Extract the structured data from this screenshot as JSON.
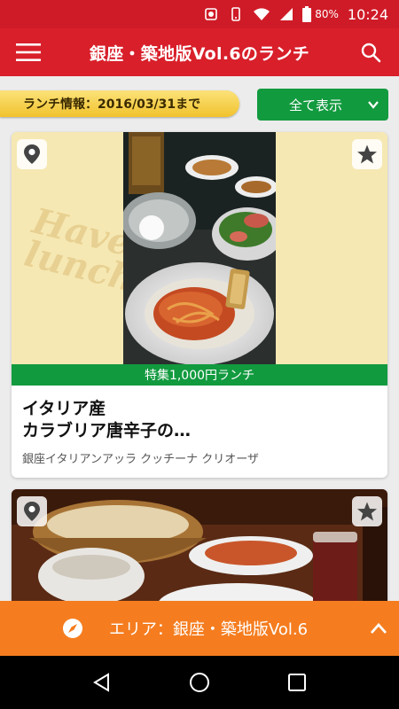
{
  "status": {
    "battery": "80%",
    "time": "10:24"
  },
  "app_bar": {
    "title": "銀座・築地版Vol.6のランチ"
  },
  "info": {
    "banner": "ランチ情報：2016/03/31まで",
    "show_all": "全て表示"
  },
  "cards": [
    {
      "bg_text": "Have a nice lunch!",
      "tag": "特集1,000円ランチ",
      "title_line1": "イタリア産",
      "title_line2": "カラブリア唐辛子の…",
      "shop": "銀座イタリアンアッラ クッチーナ クリオーザ"
    }
  ],
  "area_bar": {
    "label": "エリア：銀座・築地版Vol.6"
  },
  "colors": {
    "brand_red": "#d81f2a",
    "accent_green": "#129a3f",
    "area_orange": "#f57d1f",
    "banner_yellow": "#f1c22c"
  },
  "icons": [
    "menu-icon",
    "search-icon",
    "chevron-down-icon",
    "map-pin-icon",
    "star-icon",
    "compass-icon",
    "chevron-up-icon",
    "back-icon",
    "home-icon",
    "recents-icon"
  ]
}
